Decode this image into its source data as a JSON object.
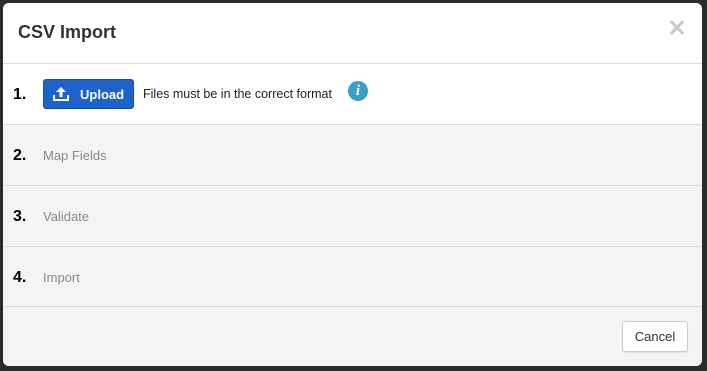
{
  "dialog": {
    "title": "CSV Import",
    "close_icon": "close-icon"
  },
  "steps": [
    {
      "number": "1.",
      "label": "Upload",
      "active": true
    },
    {
      "number": "2.",
      "label": "Map Fields",
      "active": false
    },
    {
      "number": "3.",
      "label": "Validate",
      "active": false
    },
    {
      "number": "4.",
      "label": "Import",
      "active": false
    }
  ],
  "upload": {
    "button_label": "Upload",
    "icon": "upload-icon",
    "hint": "Files must be in the correct format",
    "info_icon": "info-icon",
    "info_glyph": "i"
  },
  "footer": {
    "cancel_label": "Cancel"
  },
  "colors": {
    "primary": "#1d63c9",
    "info": "#3a9fc7",
    "inactive_bg": "#f4f4f4"
  }
}
